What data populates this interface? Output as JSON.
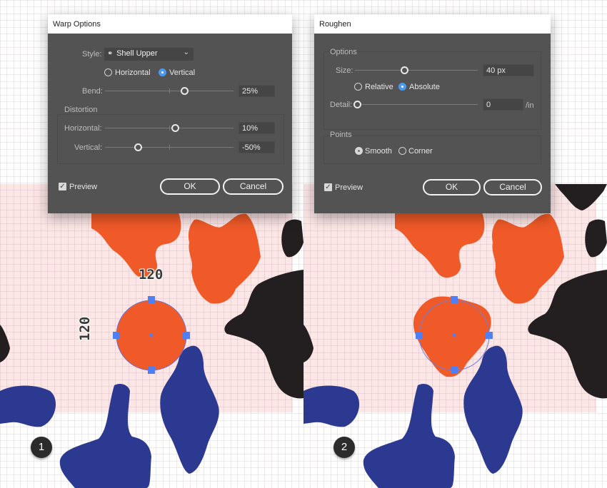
{
  "colors": {
    "orange": "#f05a28",
    "navy": "#2c3990",
    "black": "#231f20",
    "pink_bg": "#fce6e6",
    "selection_blue": "#4f7ff5",
    "dialog_bg": "#535353",
    "radio_active": "#4a9af5"
  },
  "panels": [
    {
      "step": "1",
      "dimension_width": "120",
      "dimension_height": "120",
      "dialog": {
        "title": "Warp Options",
        "style_label": "Style:",
        "style_icon": "shell-upper-icon",
        "style_value": "Shell Upper",
        "orientation_options": [
          "Horizontal",
          "Vertical"
        ],
        "orientation_selected": "Vertical",
        "bend_label": "Bend:",
        "bend_value": "25%",
        "bend_slider_value": 25,
        "distortion_title": "Distortion",
        "horizontal_label": "Horizontal:",
        "horizontal_value": "10%",
        "horizontal_slider_value": 10,
        "vertical_label": "Vertical:",
        "vertical_value": "-50%",
        "vertical_slider_value": -50,
        "preview_label": "Preview",
        "preview_checked": true,
        "ok_label": "OK",
        "cancel_label": "Cancel"
      }
    },
    {
      "step": "2",
      "dialog": {
        "title": "Roughen",
        "options_title": "Options",
        "size_label": "Size:",
        "size_value": "40 px",
        "size_slider_fraction": 0.4,
        "size_mode_options": [
          "Relative",
          "Absolute"
        ],
        "size_mode_selected": "Absolute",
        "detail_label": "Detail:",
        "detail_value": "0",
        "detail_unit": "/in",
        "detail_slider_fraction": 0,
        "points_title": "Points",
        "points_options": [
          "Smooth",
          "Corner"
        ],
        "points_selected": "Smooth",
        "preview_label": "Preview",
        "preview_checked": true,
        "ok_label": "OK",
        "cancel_label": "Cancel"
      }
    }
  ]
}
